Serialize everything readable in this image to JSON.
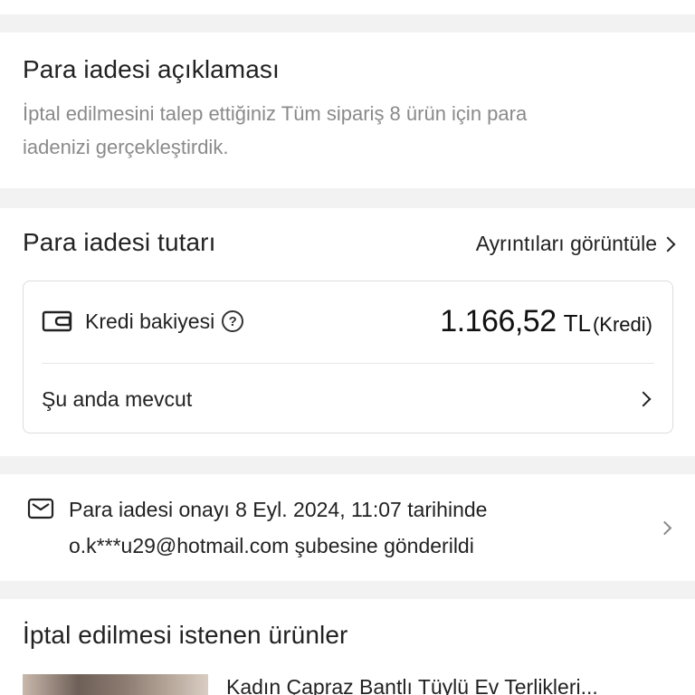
{
  "description_section": {
    "title": "Para iadesi açıklaması",
    "text_line1": "İptal edilmesini talep ettiğiniz Tüm sipariş 8 ürün için para",
    "text_line2": "iadenizi gerçekleştirdik."
  },
  "amount_section": {
    "title": "Para iadesi tutarı",
    "details_link": "Ayrıntıları görüntüle",
    "credit_label": "Kredi bakiyesi",
    "help_icon_char": "?",
    "amount_value": "1.166,52",
    "currency": "TL",
    "amount_note": "(Kredi)",
    "availability_label": "Şu anda mevcut"
  },
  "notification_section": {
    "line1": "Para iadesi onayı 8 Eyl. 2024, 11:07 tarihinde",
    "line2": "o.k***u29@hotmail.com şubesine gönderildi"
  },
  "products_section": {
    "title": "İptal edilmesi istenen ürünler",
    "items": [
      {
        "name": "Kadın Çapraz Bantlı Tüylü Ev Terlikleri..."
      }
    ]
  },
  "icons": {
    "wallet": "wallet-icon",
    "help": "help-circle-icon",
    "mail": "mail-icon",
    "chevron": "chevron-right-icon"
  }
}
